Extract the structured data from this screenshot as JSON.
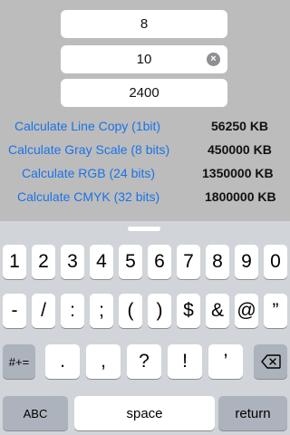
{
  "fields": [
    {
      "value": "8"
    },
    {
      "value": "10",
      "clear_glyph": "×"
    },
    {
      "value": "2400"
    }
  ],
  "calculations": [
    {
      "label": "Calculate Line Copy (1bit)",
      "result": "56250 KB"
    },
    {
      "label": "Calculate Gray Scale (8 bits)",
      "result": "450000 KB"
    },
    {
      "label": "Calculate RGB (24 bits)",
      "result": "1350000 KB"
    },
    {
      "label": "Calculate CMYK (32 bits)",
      "result": "1800000 KB"
    }
  ],
  "keyboard": {
    "row1": [
      "1",
      "2",
      "3",
      "4",
      "5",
      "6",
      "7",
      "8",
      "9",
      "0"
    ],
    "row2": [
      "-",
      "/",
      ":",
      ";",
      "(",
      ")",
      "$",
      "&",
      "@",
      "”"
    ],
    "row3_mode": "#+=",
    "row3": [
      ".",
      ",",
      "?",
      "!",
      "’"
    ],
    "backspace_icon": "backspace-icon",
    "abc": "ABC",
    "space": "space",
    "return": "return"
  },
  "colors": {
    "link": "#1a73e8",
    "background": "#bcbcbc",
    "keyboard_bg": "#d1d4d9",
    "key_dark": "#adb3bc"
  }
}
